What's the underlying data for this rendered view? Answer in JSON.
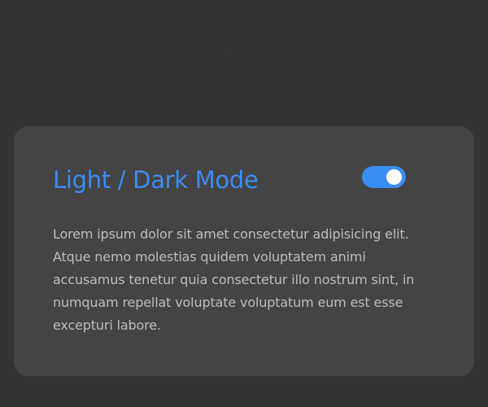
{
  "theme": {
    "background": "#333333",
    "card_background": "#444444",
    "accent": "#3b8df5",
    "moon_color": "#f1c40f",
    "text_color": "#bdbdbd"
  },
  "header": {
    "icon": "moon-icon"
  },
  "card": {
    "title": "Light / Dark Mode",
    "toggle": {
      "state": "on",
      "icon": "toggle-switch"
    },
    "body": "Lorem ipsum dolor sit amet consectetur adipisicing elit. Atque nemo molestias quidem voluptatem animi accusamus tenetur quia consectetur illo nostrum sint, in numquam repellat voluptate voluptatum eum est esse excepturi labore."
  }
}
